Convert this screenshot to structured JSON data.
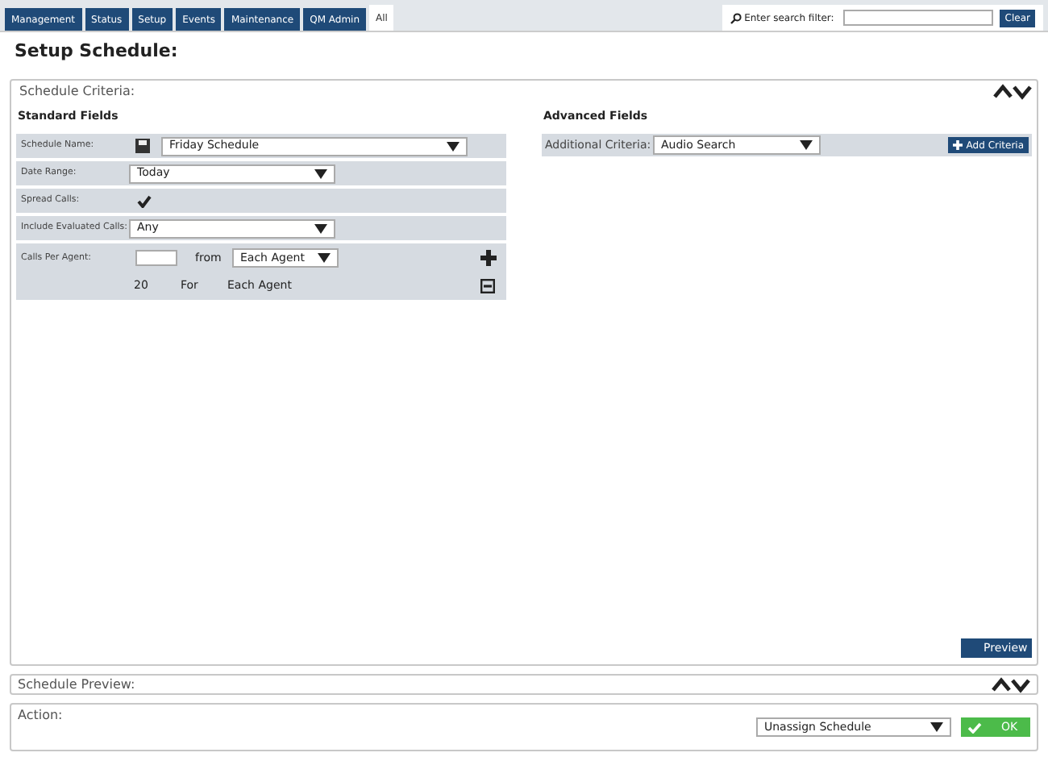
{
  "tabs": [
    {
      "label": "Management",
      "selected": false
    },
    {
      "label": "Status",
      "selected": false
    },
    {
      "label": "Setup",
      "selected": false
    },
    {
      "label": "Events",
      "selected": false
    },
    {
      "label": "Maintenance",
      "selected": false
    },
    {
      "label": "QM Admin",
      "selected": false
    },
    {
      "label": "All",
      "selected": true
    }
  ],
  "search": {
    "label": "Enter search filter:",
    "button": "Clear"
  },
  "page_title": "Setup Schedule:",
  "criteria": {
    "title": "Schedule Criteria:",
    "standard_title": "Standard Fields",
    "standard_fields": [
      {
        "kind": "name",
        "label": "Schedule Name:",
        "value": "Friday Schedule"
      },
      {
        "kind": "select",
        "label": "Date Range:",
        "value": "Today"
      },
      {
        "kind": "check",
        "label": "Spread Calls:",
        "checked": true
      },
      {
        "kind": "select",
        "label": "Include Evaluated Calls:",
        "value": "Any"
      },
      {
        "kind": "calls",
        "label": "Calls Per Agent:",
        "from": "from",
        "value": "Each Agent",
        "entry": {
          "count": "20",
          "for": "For",
          "per": "Each Agent"
        }
      }
    ],
    "advanced_title": "Advanced Fields",
    "advanced": {
      "label": "Additional Criteria:",
      "value": "Audio Search",
      "button": "Add Criteria"
    },
    "preview_button": "Preview"
  },
  "preview": {
    "title": "Schedule Preview:"
  },
  "action": {
    "title": "Action:",
    "value": "Unassign Schedule",
    "button": "OK"
  }
}
